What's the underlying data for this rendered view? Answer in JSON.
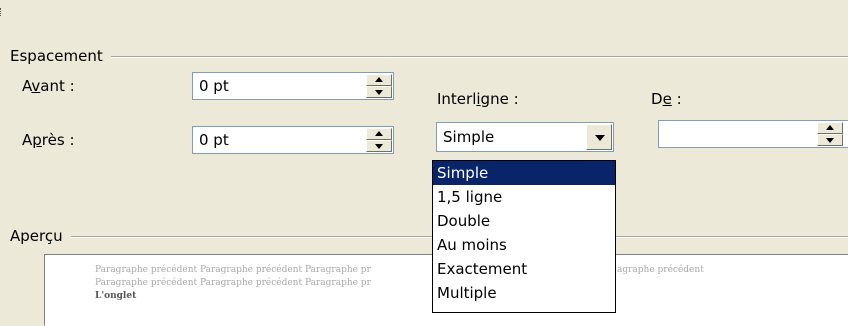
{
  "spacing": {
    "title": "Espacement",
    "before_label_prefix": "A",
    "before_label_accel": "v",
    "before_label_suffix": "ant :",
    "before_value": "0 pt",
    "after_label_prefix": "A",
    "after_label_accel": "p",
    "after_label_suffix": "rès :",
    "after_value": "0 pt"
  },
  "line_spacing": {
    "label_prefix": "Interl",
    "label_accel": "i",
    "label_suffix": "gne :",
    "value": "Simple",
    "options": [
      "Simple",
      "1,5 ligne",
      "Double",
      "Au moins",
      "Exactement",
      "Multiple"
    ],
    "selected_index": 0
  },
  "at": {
    "label_prefix": "D",
    "label_accel": "e",
    "label_suffix": " :",
    "value": ""
  },
  "preview": {
    "title": "Aperçu",
    "line1_left": "Paragraphe précédent Paragraphe précédent Paragraphe pr",
    "line1_right": "agraphe précédent",
    "line2_left": "Paragraphe précédent Paragraphe précédent Paragraphe pr",
    "bold_text": "L'onglet"
  },
  "icons": {
    "spin_up": "arrow-up-icon",
    "spin_down": "arrow-down-icon",
    "dropdown": "chevron-down-icon"
  },
  "colors": {
    "dialog_bg": "#ece9d8",
    "selection_bg": "#0a246a",
    "field_border": "#7f9db9"
  }
}
